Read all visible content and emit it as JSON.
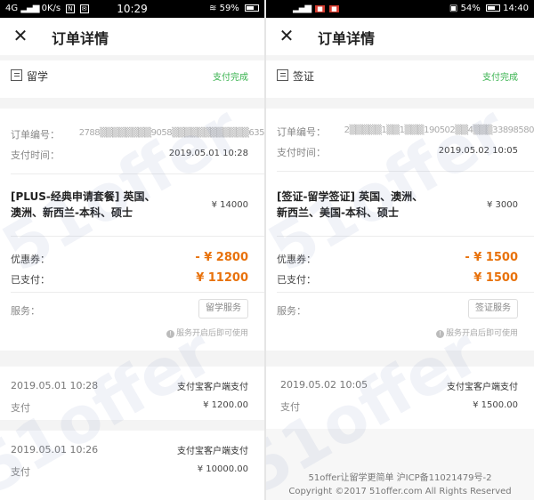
{
  "left": {
    "status_bar": {
      "left": "4G",
      "speed": "0K/s",
      "time": "10:29",
      "battery": "59%"
    },
    "nav": {
      "title": "订单详情"
    },
    "section": {
      "type": "留学",
      "status": "支付完成"
    },
    "order_number_label": "订单编号：",
    "order_number": "2788▒▒▒▒▒▒▒▒9058▒▒▒▒▒▒▒▒▒▒▒▒635",
    "pay_time_label": "支付时间：",
    "pay_time": "2019.05.01 10:28",
    "product_line1": "[PLUS-经典申请套餐] 英国、",
    "product_line2": "澳洲、新西兰-本科、硕士",
    "price": "¥ 14000",
    "coupon_label": "优惠券：",
    "coupon": "- ¥ 2800",
    "paid_label": "已支付：",
    "paid": "¥ 11200",
    "service_label": "服务：",
    "service_button": "留学服务",
    "hint": "服务开启后即可使用",
    "payments": [
      {
        "date": "2019.05.01 10:28",
        "method": "支付宝客户端支付",
        "label": "支付",
        "amount": "¥ 1200.00"
      },
      {
        "date": "2019.05.01 10:26",
        "method": "支付宝客户端支付",
        "label": "支付",
        "amount": "¥ 10000.00"
      }
    ]
  },
  "right": {
    "status_bar": {
      "time": "14:40",
      "battery": "54%"
    },
    "nav": {
      "title": "订单详情"
    },
    "section": {
      "type": "签证",
      "status": "支付完成"
    },
    "order_number_label": "订单编号：",
    "order_number": "2▒▒▒▒▒1▒▒1▒▒▒190502▒▒4▒▒▒33898580",
    "pay_time_label": "支付时间：",
    "pay_time": "2019.05.02 10:05",
    "product_line1": "[签证-留学签证] 英国、澳洲、",
    "product_line2": "新西兰、美国-本科、硕士",
    "price": "¥ 3000",
    "coupon_label": "优惠券：",
    "coupon": "- ¥ 1500",
    "paid_label": "已支付：",
    "paid": "¥ 1500",
    "service_label": "服务：",
    "service_button": "签证服务",
    "hint": "服务开启后即可使用",
    "payments": [
      {
        "date": "2019.05.02 10:05",
        "method": "支付宝客户端支付",
        "label": "支付",
        "amount": "¥ 1500.00"
      }
    ],
    "footer_line1": "51offer让留学更简单 沪ICP备11021479号-2",
    "footer_line2": "Copyright ©2017 51offer.com All Rights Reserved"
  },
  "colors": {
    "accent_orange": "#e8720c",
    "status_green": "#37b24d"
  },
  "icons": {
    "close": "close-icon",
    "type": "document-icon",
    "info": "info-icon"
  }
}
